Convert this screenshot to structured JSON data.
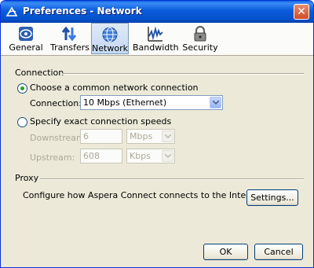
{
  "window": {
    "title": "Preferences - Network"
  },
  "tabs": [
    {
      "label": "General",
      "icon": "aspera-logo-icon"
    },
    {
      "label": "Transfers",
      "icon": "transfer-arrows-icon"
    },
    {
      "label": "Network",
      "icon": "globe-icon",
      "active": true
    },
    {
      "label": "Bandwidth",
      "icon": "bandwidth-graph-icon"
    },
    {
      "label": "Security",
      "icon": "padlock-icon"
    }
  ],
  "connection": {
    "section_label": "Connection",
    "option_common": "Choose a common network connection",
    "connection_label": "Connection:",
    "connection_value": "10 Mbps (Ethernet)",
    "option_exact": "Specify exact connection speeds",
    "downstream_label": "Downstream:",
    "downstream_value": "6",
    "downstream_unit": "Mbps",
    "upstream_label": "Upstream:",
    "upstream_value": "608",
    "upstream_unit": "Kbps",
    "selected_option": "common"
  },
  "proxy": {
    "section_label": "Proxy",
    "description": "Configure how Aspera Connect connects to the Internet",
    "settings_button": "Settings..."
  },
  "footer": {
    "ok_label": "OK",
    "cancel_label": "Cancel"
  },
  "colors": {
    "titlebar": "#0a5bdc",
    "dialog_bg": "#ece9d8",
    "accent_radio": "#21a121"
  }
}
